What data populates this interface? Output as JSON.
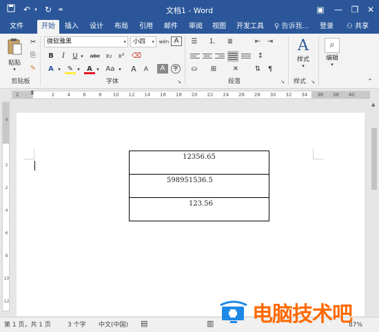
{
  "titlebar": {
    "title": "文档1 - Word",
    "save_icon": "save-icon",
    "undo_icon": "undo-icon",
    "redo_icon": "redo-icon",
    "customize_icon": "customize-qat-icon",
    "options_icon": "ribbon-display-options-icon",
    "minimize_icon": "minimize-icon",
    "restore_icon": "restore-icon",
    "close_icon": "close-icon"
  },
  "tabs": [
    {
      "label": "文件"
    },
    {
      "label": "开始",
      "active": true
    },
    {
      "label": "插入"
    },
    {
      "label": "设计"
    },
    {
      "label": "布局"
    },
    {
      "label": "引用"
    },
    {
      "label": "邮件"
    },
    {
      "label": "审阅"
    },
    {
      "label": "视图"
    },
    {
      "label": "开发工具"
    }
  ],
  "tell_me": "♀ 告诉我...",
  "login": "登录",
  "share": "共享",
  "ribbon": {
    "clipboard": {
      "paste_label": "粘贴",
      "group_label": "剪贴板"
    },
    "font": {
      "font_name": "微软雅黑",
      "font_size": "小四",
      "wen": "wén",
      "bold": "B",
      "italic": "I",
      "underline": "U",
      "strike": "abc",
      "subscript": "x₂",
      "superscript": "x²",
      "font_color_letter": "A",
      "change_case": "Aa",
      "grow": "A",
      "shrink": "A",
      "border_char": "A",
      "group_label": "字体"
    },
    "paragraph": {
      "group_label": "段落"
    },
    "styles": {
      "label": "样式",
      "group_label": "样式"
    },
    "editing": {
      "label": "编辑"
    }
  },
  "ruler": {
    "h_ticks": [
      "2",
      "2",
      "4",
      "6",
      "8",
      "10",
      "12",
      "14",
      "16",
      "18",
      "20",
      "22",
      "24",
      "26",
      "28",
      "30",
      "32",
      "34",
      "36",
      "38",
      "40"
    ],
    "v_ticks": [
      "4",
      "2",
      "2",
      "4",
      "6",
      "8",
      "10",
      "12",
      "14"
    ]
  },
  "document": {
    "table": [
      {
        "value": "12356.65"
      },
      {
        "value": "598951536.5"
      },
      {
        "value": "123.56"
      }
    ]
  },
  "statusbar": {
    "page": "第 1 页，共 1 页",
    "words": "3 个字",
    "language": "中文(中国)",
    "zoom": "87%"
  },
  "watermark": {
    "text": "电脑技术吧"
  }
}
